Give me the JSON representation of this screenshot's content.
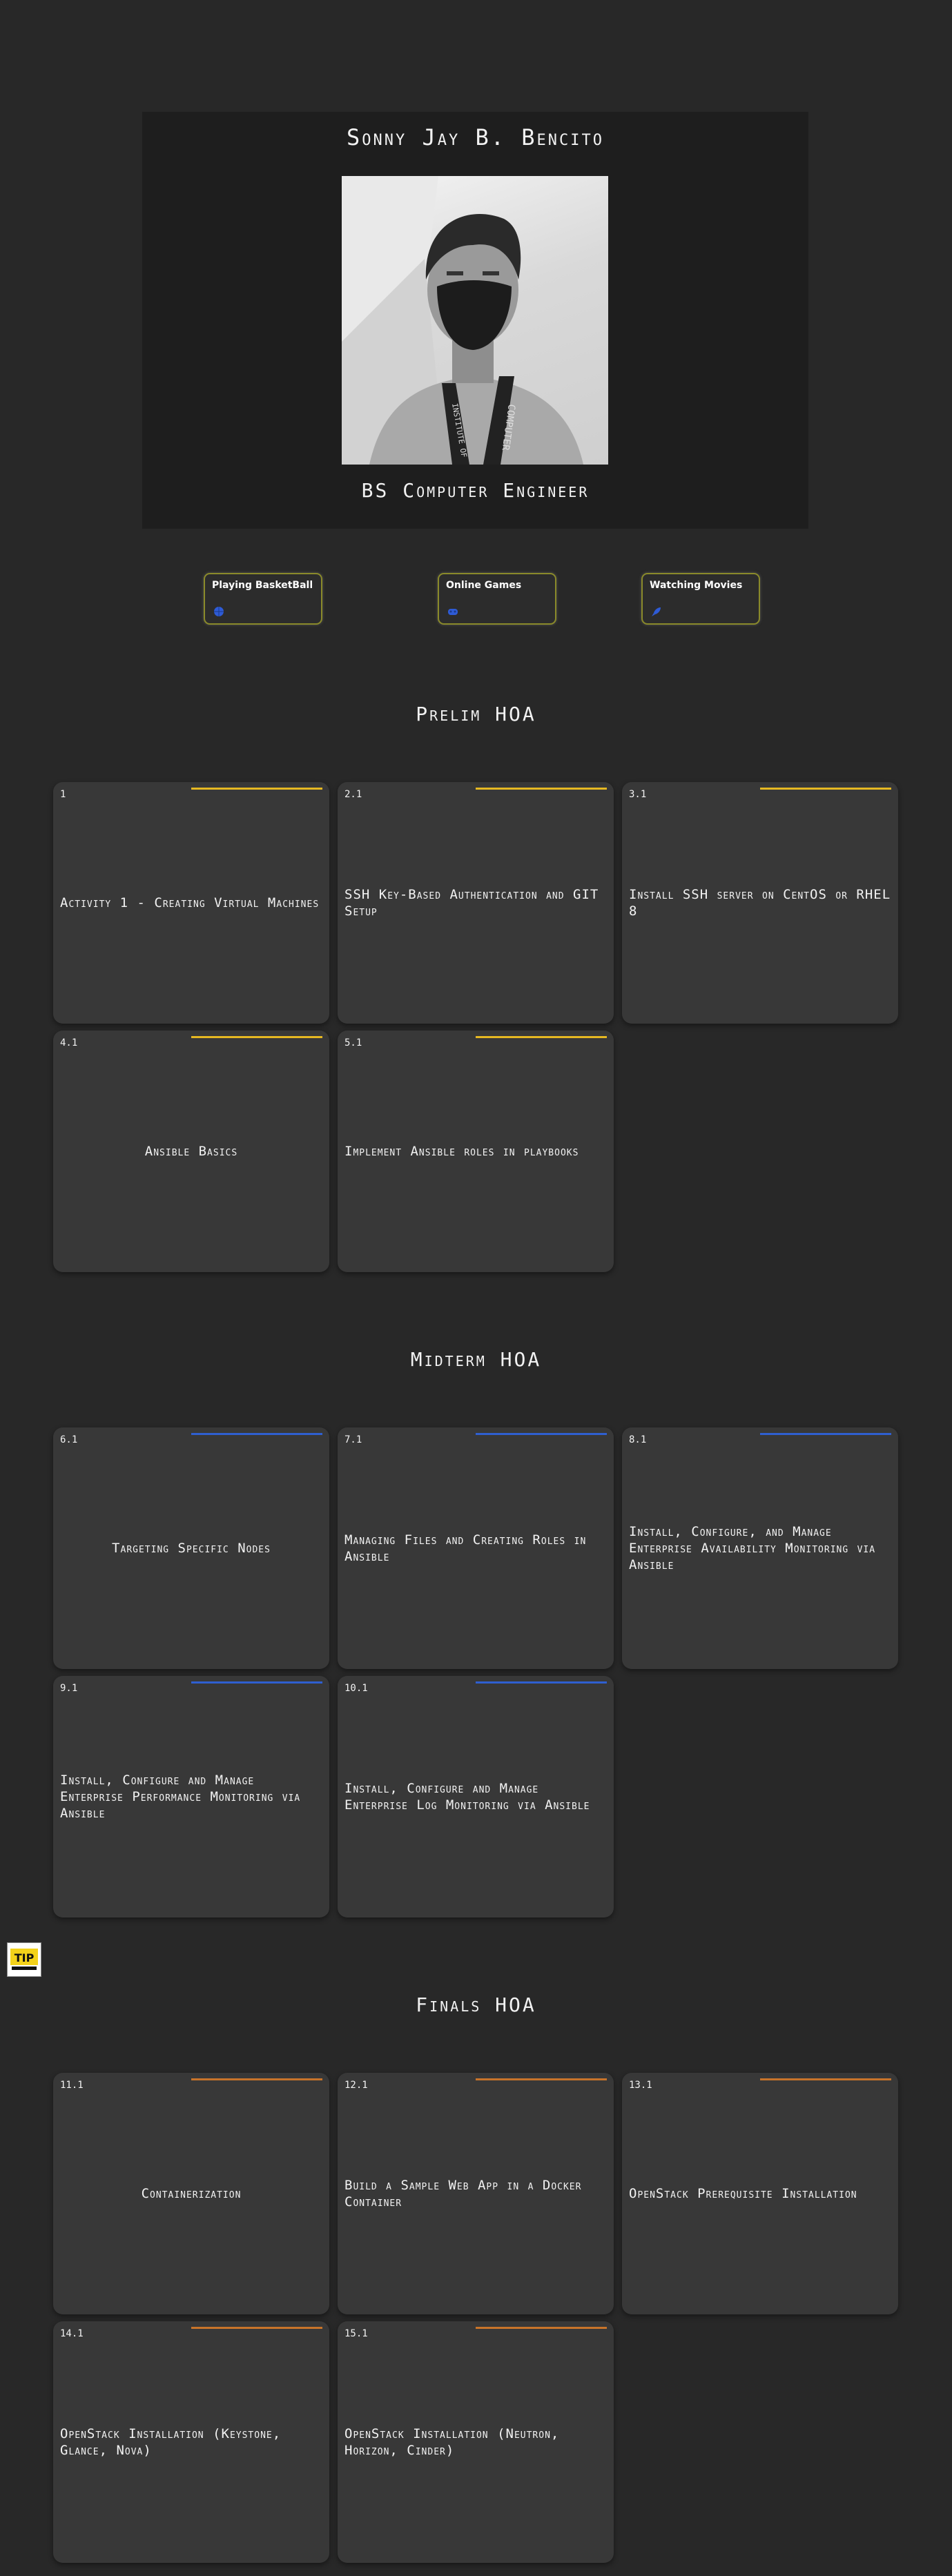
{
  "profile": {
    "name": "Sonny Jay B. Bencito",
    "degree": "BS Computer Engineer",
    "lanyard_text": "COMPUTER",
    "lanyard_text2": "INSTITUTE OF"
  },
  "hobbies": [
    {
      "label": "Playing BasketBall",
      "icon": "basketball-icon",
      "color": "#2e5bd6"
    },
    {
      "label": "Online Games",
      "icon": "gamepad-icon",
      "color": "#2e5bd6"
    },
    {
      "label": "Watching Movies",
      "icon": "rocket-icon",
      "color": "#2e5bd6"
    }
  ],
  "sections": {
    "prelim": {
      "title": "Prelim HOA",
      "accent": "#e6b822",
      "cards": [
        {
          "num": "1",
          "title": "Activity 1 - Creating Virtual Machines"
        },
        {
          "num": "2.1",
          "title": "SSH Key-Based Authentication and GIT Setup"
        },
        {
          "num": "3.1",
          "title": "Install SSH server on CentOS or RHEL 8"
        },
        {
          "num": "4.1",
          "title": "Ansible Basics"
        },
        {
          "num": "5.1",
          "title": "Implement Ansible roles in playbooks"
        }
      ]
    },
    "midterm": {
      "title": "Midterm HOA",
      "accent": "#2f5fd0",
      "cards": [
        {
          "num": "6.1",
          "title": "Targeting Specific Nodes"
        },
        {
          "num": "7.1",
          "title": "Managing Files and Creating Roles in Ansible"
        },
        {
          "num": "8.1",
          "title": "Install, Configure, and Manage Enterprise Availability Monitoring via Ansible"
        },
        {
          "num": "9.1",
          "title": "Install, Configure and Manage Enterprise Performance Monitoring via Ansible"
        },
        {
          "num": "10.1",
          "title": "Install, Configure and Manage Enterprise Log Monitoring via Ansible"
        }
      ]
    },
    "finals": {
      "title": "Finals HOA",
      "accent": "#c8742a",
      "cards": [
        {
          "num": "11.1",
          "title": "Containerization"
        },
        {
          "num": "12.1",
          "title": "Build a Sample Web App in a Docker Container"
        },
        {
          "num": "13.1",
          "title": "OpenStack Prerequisite Installation"
        },
        {
          "num": "14.1",
          "title": "OpenStack Installation (Keystone, Glance, Nova)"
        },
        {
          "num": "15.1",
          "title": "OpenStack Installation (Neutron, Horizon, Cinder)"
        }
      ]
    }
  },
  "logo": {
    "text": "TIP"
  }
}
